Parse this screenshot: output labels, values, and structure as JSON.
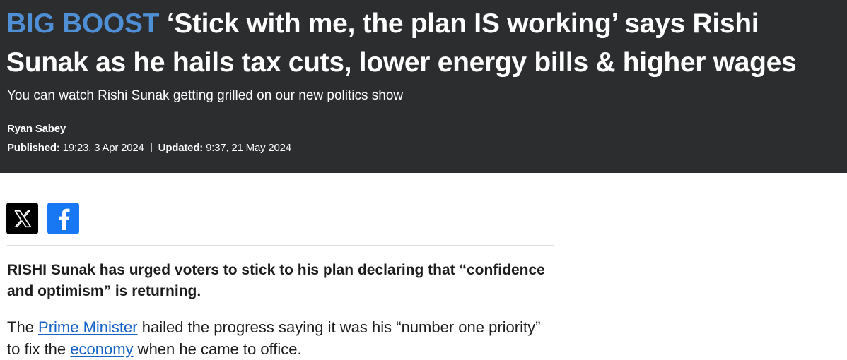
{
  "article": {
    "kicker": "BIG BOOST",
    "headline": "‘Stick with me, the plan IS working’ says Rishi Sunak as he hails tax cuts, lower energy bills & higher wages",
    "standfirst": "You can watch Rishi Sunak getting grilled on our new politics show",
    "author": "Ryan Sabey",
    "published_label": "Published:",
    "published": "19:23, 3 Apr 2024",
    "updated_label": "Updated:",
    "updated": "9:37, 21 May 2024",
    "lead": "RISHI Sunak has urged voters to stick to his plan declaring that “confidence and optimism” is returning.",
    "body": {
      "p1_a": "The ",
      "link1": "Prime Minister",
      "p1_b": " hailed the progress saying it was his “number one priority” to fix the ",
      "link2": "economy",
      "p1_c": " when he came to office."
    }
  },
  "share": {
    "x_icon": "x-logo-icon",
    "facebook_icon": "facebook-logo-icon"
  },
  "colors": {
    "header_bg": "#2b2d2f",
    "kicker": "#4f8fd6",
    "link": "#1563c6",
    "facebook": "#1877f2"
  }
}
